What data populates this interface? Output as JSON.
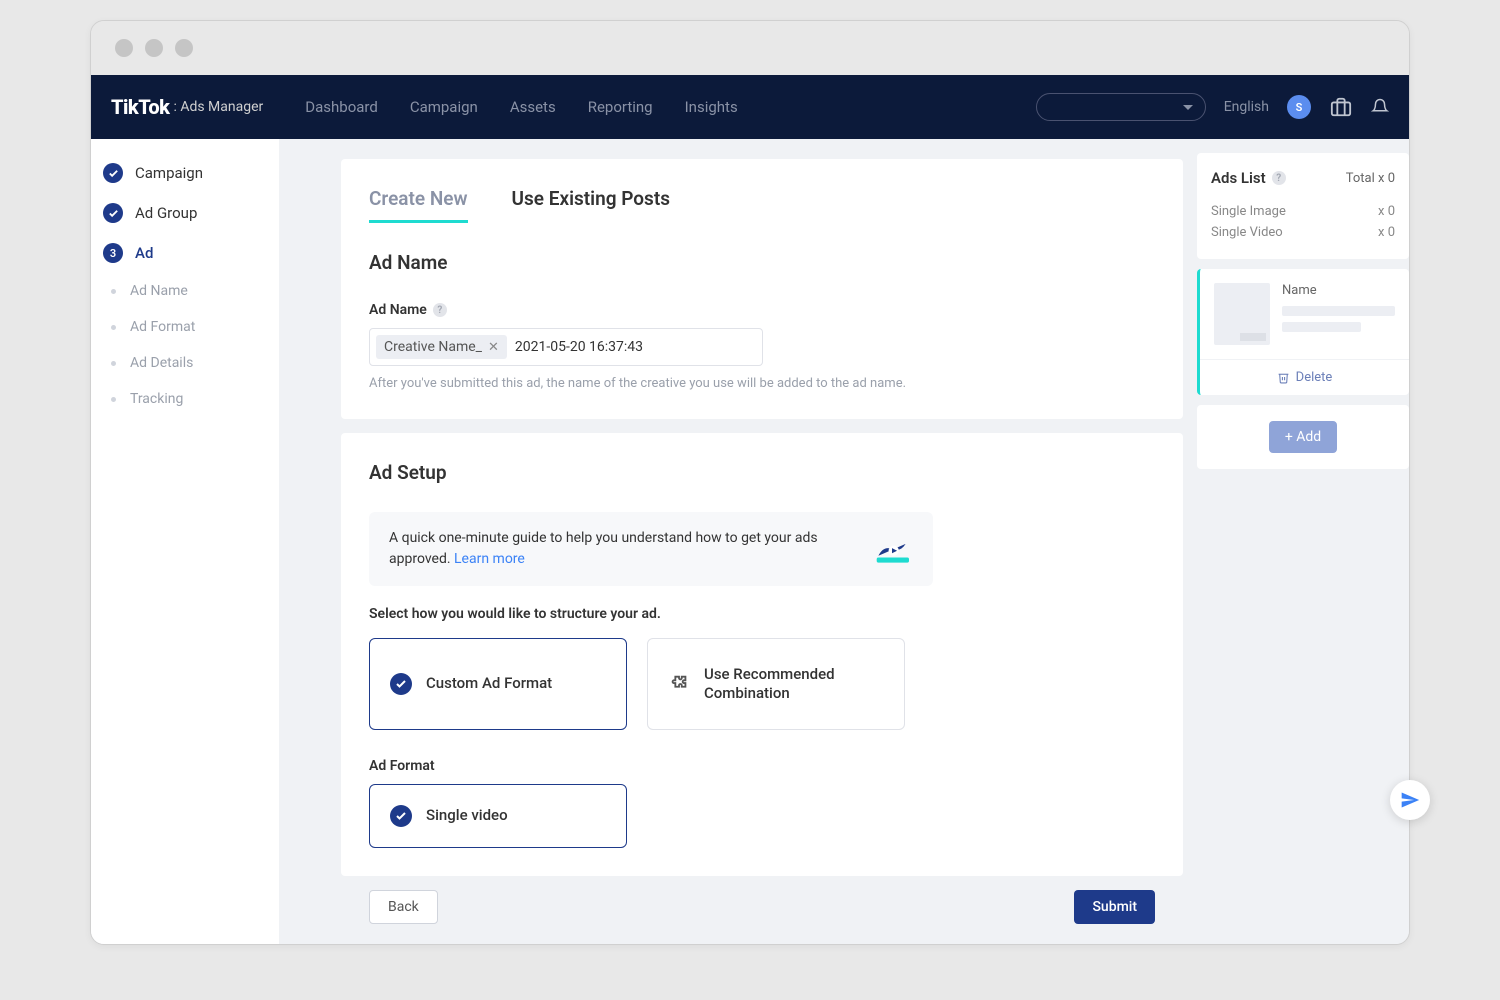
{
  "logo": {
    "brand": "TikTok",
    "sub": ": Ads Manager"
  },
  "nav": {
    "links": [
      "Dashboard",
      "Campaign",
      "Assets",
      "Reporting",
      "Insights"
    ],
    "language": "English",
    "avatar_letter": "S"
  },
  "sidebar": {
    "steps": [
      {
        "label": "Campaign",
        "state": "done"
      },
      {
        "label": "Ad Group",
        "state": "done"
      },
      {
        "label": "Ad",
        "state": "current",
        "num": "3"
      }
    ],
    "subs": [
      "Ad Name",
      "Ad Format",
      "Ad Details",
      "Tracking"
    ]
  },
  "tabs": {
    "create": "Create New",
    "existing": "Use Existing Posts"
  },
  "ad_name_section": {
    "title": "Ad Name",
    "label": "Ad Name",
    "chip": "Creative Name_",
    "value": "2021-05-20 16:37:43",
    "hint": "After you've submitted this ad, the name of the creative you use will be added to the ad name."
  },
  "ad_setup": {
    "title": "Ad Setup",
    "banner": "A quick one-minute guide to help you understand how to get your ads approved.",
    "learn_more": "Learn more",
    "select_label": "Select how you would like to structure your ad.",
    "opt_custom": "Custom Ad Format",
    "opt_recommended": "Use Recommended Combination",
    "format_label": "Ad Format",
    "format_single": "Single video"
  },
  "footer": {
    "back": "Back",
    "submit": "Submit"
  },
  "ads_list": {
    "title": "Ads List",
    "total": "Total x 0",
    "rows": [
      {
        "name": "Single Image",
        "count": "x 0"
      },
      {
        "name": "Single Video",
        "count": "x 0"
      }
    ],
    "preview_name": "Name",
    "delete": "Delete",
    "add": "+ Add"
  }
}
